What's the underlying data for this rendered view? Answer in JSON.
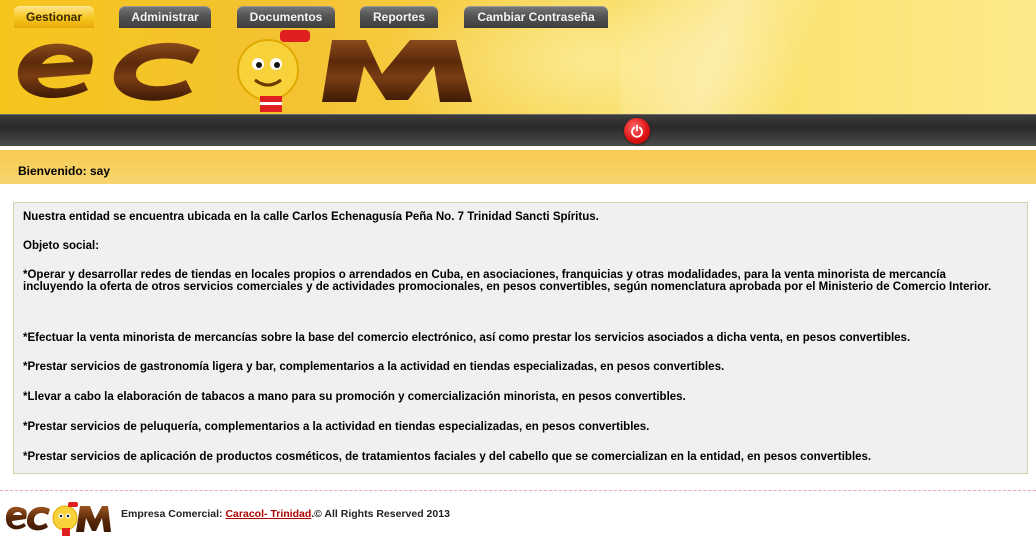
{
  "header": {
    "logo_text": "ecom"
  },
  "nav": {
    "tabs": [
      {
        "label": "Gestionar",
        "active": true
      },
      {
        "label": "Administrar",
        "active": false
      },
      {
        "label": "Documentos",
        "active": false
      },
      {
        "label": "Reportes",
        "active": false
      },
      {
        "label": "Cambiar Contraseña",
        "active": false
      }
    ],
    "logout_icon": "power-icon"
  },
  "welcome": {
    "text": "Bienvenido: say"
  },
  "content": {
    "intro": "Nuestra entidad se encuentra ubicada en la calle Carlos Echenagusía Peña No. 7 Trinidad Sancti Spíritus.",
    "objeto_heading": "Objeto social:",
    "items": [
      "*Operar y desarrollar redes de tiendas en locales propios o arrendados en Cuba, en asociaciones, franquicias y otras modalidades, para la venta minorista de mercancía incluyendo la oferta de otros servicios comerciales y de actividades promocionales, en pesos convertibles, según nomenclatura aprobada por el Ministerio de Comercio Interior.",
      "*Efectuar la venta minorista de mercancías sobre la base del comercio electrónico, así como prestar los servicios asociados a dicha venta, en pesos convertibles.",
      "*Prestar servicios de gastronomía ligera y bar, complementarios a la actividad en tiendas especializadas, en pesos convertibles.",
      "*Llevar a cabo la elaboración de tabacos a mano para su promoción y comercialización minorista, en pesos convertibles.",
      "*Prestar servicios de peluquería, complementarios a la actividad en tiendas especializadas, en pesos convertibles.",
      "*Prestar servicios de aplicación de productos cosméticos, de tratamientos faciales y del cabello que se comercializan en la entidad, en pesos convertibles."
    ]
  },
  "footer": {
    "prefix": "Empresa Comercial: ",
    "link_text": "Caracol- Trinidad",
    "suffix": ".© All Rights Reserved 2013",
    "logo_text": "ecom"
  },
  "colors": {
    "banner": "#f6c51c",
    "active_tab": "#f7c51e",
    "navbar": "#2a2a2a",
    "welcome_bar": "#f7ca52",
    "panel_bg": "#eef0f2",
    "link": "#b00000"
  }
}
